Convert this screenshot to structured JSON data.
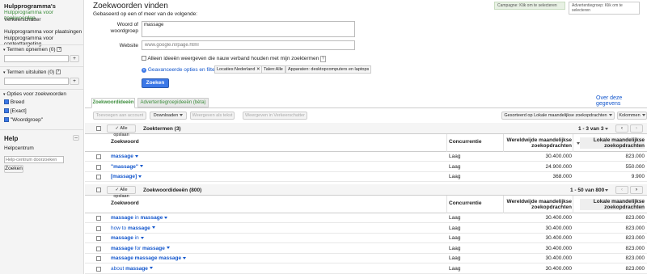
{
  "sidebar": {
    "title": "Hulpprogramma's",
    "tools": [
      "Hulpprogramma voor zoekwoorden",
      "Verkeerschatter"
    ],
    "tools2": [
      "Hulpprogramma voor plaatsingen",
      "Hulpprogramma voor contexttargeting"
    ],
    "include_label": "Termen opnemen (0)",
    "exclude_label": "Termen uitsluiten (0)",
    "plus": "+",
    "match_label": "Opties voor zoekwoorden",
    "match_options": [
      "Breed",
      "[Exact]",
      "\"Woordgroep\""
    ],
    "help_title": "Help",
    "help_center": "Helpcentrum",
    "help_search_placeholder": "Help-centrum doorzoeken",
    "search_button": "Zoeken"
  },
  "main": {
    "title": "Zoekwoorden vinden",
    "subtitle": "Gebaseerd op een of meer van de volgende:",
    "campaign_box": "Campagne: Klik om te selecteren",
    "adgroup_box": "Advertentiegroep: Klik om te selecteren",
    "word_label": "Woord of woordgroep",
    "word_value": "massage",
    "website_label": "Website",
    "website_placeholder": "www.google.nl/page.html",
    "related_only": "Alleen ideeën weergeven die nauw verband houden met mijn zoektermen",
    "help_q": "?",
    "advanced": "Geavanceerde opties en filters",
    "chips": [
      "Locaties:Nederland",
      "Talen:Alle",
      "Apparaten: desktopcomputers en laptops"
    ],
    "chip_close": "✕",
    "search_button": "Zoeken",
    "about_link": "Over deze gegevens",
    "tabs": [
      "Zoekwoordideeën",
      "Advertentiegroepideeën (bèta)"
    ],
    "toolbar": {
      "add": "Toevoegen aan account",
      "download": "Downloaden",
      "view_text": "Weergeven als tekst",
      "view_estimator": "Weergeven in Verkeerschatter",
      "sort": "Gesorteerd op Lokale maandelijkse zoekopdrachten",
      "columns": "Kolommen"
    },
    "save_all": "Alle opslaan",
    "columns": {
      "keyword": "Zoekwoord",
      "competition": "Concurrentie",
      "global": "Wereldwijde maandelijkse zoekopdrachten",
      "local": "Lokale maandelijkse zoekopdrachten",
      "help": "?"
    },
    "section1": {
      "title": "Zoektermen (3)",
      "pager": "1 - 3 van 3",
      "rows": [
        {
          "keyword": "massage",
          "competition": "Laag",
          "global": "30.400.000",
          "local": "823.000"
        },
        {
          "keyword": "\"massage\"",
          "competition": "Laag",
          "global": "24.900.000",
          "local": "550.000"
        },
        {
          "keyword": "[massage]",
          "competition": "Laag",
          "global": "368.000",
          "local": "9.900"
        }
      ]
    },
    "section2": {
      "title": "Zoekwoordideeën (800)",
      "pager": "1 - 50 van 800",
      "rows": [
        {
          "pre": "",
          "bold": "massage",
          "mid": " in ",
          "bold2": "massage",
          "competition": "Laag",
          "global": "30.400.000",
          "local": "823.000"
        },
        {
          "pre": "how to ",
          "bold": "massage",
          "mid": "",
          "bold2": "",
          "competition": "Laag",
          "global": "30.400.000",
          "local": "823.000"
        },
        {
          "pre": "",
          "bold": "massage",
          "mid": " in",
          "bold2": "",
          "competition": "Laag",
          "global": "30.400.000",
          "local": "823.000"
        },
        {
          "pre": "",
          "bold": "massage",
          "mid": " for ",
          "bold2": "massage",
          "competition": "Laag",
          "global": "30.400.000",
          "local": "823.000"
        },
        {
          "pre": "",
          "bold": "massage massage massage",
          "mid": "",
          "bold2": "",
          "competition": "Laag",
          "global": "30.400.000",
          "local": "823.000"
        },
        {
          "pre": "about ",
          "bold": "massage",
          "mid": "",
          "bold2": "",
          "competition": "Laag",
          "global": "30.400.000",
          "local": "823.000"
        }
      ]
    }
  },
  "colors": {
    "accent": "#3b78e7",
    "link": "#1155cc",
    "active_green": "#3a8c3a"
  }
}
